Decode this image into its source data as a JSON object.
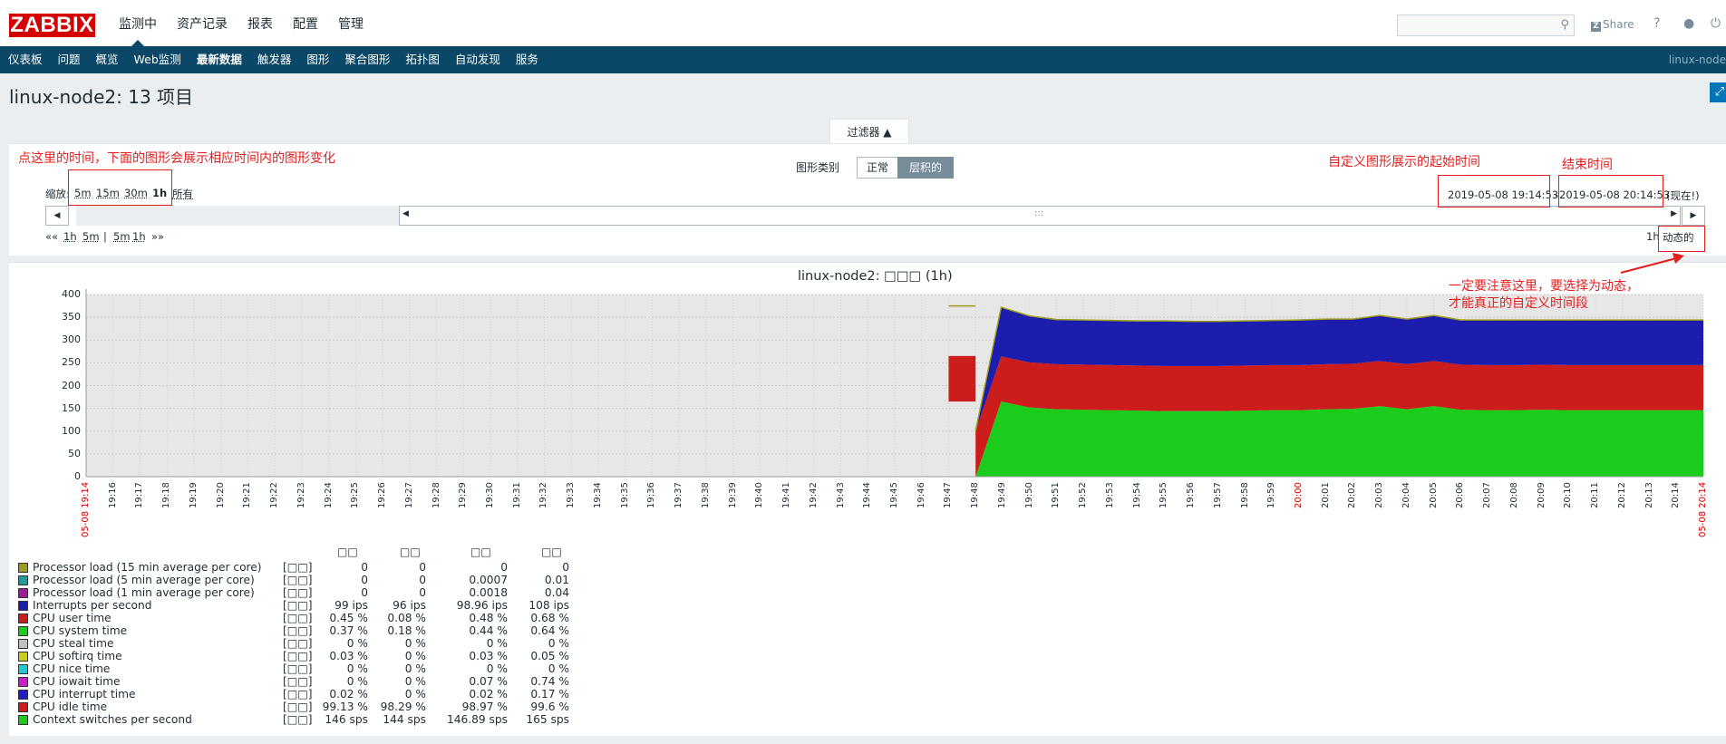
{
  "header": {
    "logo": "ZABBIX",
    "menu": [
      "监测中",
      "资产记录",
      "报表",
      "配置",
      "管理"
    ],
    "selected_menu": 0,
    "share": "Share",
    "help_icon": "?",
    "search_value": ""
  },
  "submenu": {
    "items": [
      "仪表板",
      "问题",
      "概览",
      "Web监测",
      "最新数据",
      "触发器",
      "图形",
      "聚合图形",
      "拓扑图",
      "自动发现",
      "服务"
    ],
    "selected": 4,
    "right_text": "linux-node"
  },
  "page": {
    "title": "linux-node2: 13 项目"
  },
  "filter": {
    "tab_label": "过滤器 ▲",
    "graph_type_label": "图形类别",
    "graph_type_options": [
      "正常",
      "层积的"
    ],
    "graph_type_selected": 1,
    "zoom_label": "缩放:",
    "zoom_options": [
      "5m",
      "15m",
      "30m",
      "1h",
      "所有"
    ],
    "zoom_selected": "1h",
    "date_from": "2019-05-08 19:14:53",
    "date_sep": "-",
    "date_to": "2019-05-08 20:14:53",
    "now_label": "(现在!)",
    "nav_back": [
      "«« ",
      "1h",
      "5m",
      "|",
      "5m",
      "1h",
      " »»"
    ],
    "period_label": "1h",
    "dynamic_label": "动态的"
  },
  "annotations": {
    "left": "点这里的时间，下面的图形会展示相应时间内的图形变化",
    "start": "自定义图形展示的起始时间",
    "end": "结束时间",
    "note_line1": "一定要注意这里，要选择为动态，",
    "note_line2": "才能真正的自定义时间段"
  },
  "chart_data": {
    "type": "area",
    "stacked": true,
    "title": "linux-node2: □□□ (1h)",
    "ylim": [
      0,
      400
    ],
    "yticks": [
      0,
      50,
      100,
      150,
      200,
      250,
      300,
      350,
      400
    ],
    "xticks": [
      "05-08 19:14",
      "19:16",
      "19:17",
      "19:18",
      "19:19",
      "19:20",
      "19:21",
      "19:22",
      "19:23",
      "19:24",
      "19:25",
      "19:26",
      "19:27",
      "19:28",
      "19:29",
      "19:30",
      "19:31",
      "19:32",
      "19:33",
      "19:34",
      "19:35",
      "19:36",
      "19:37",
      "19:38",
      "19:39",
      "19:40",
      "19:41",
      "19:42",
      "19:43",
      "19:44",
      "19:45",
      "19:46",
      "19:47",
      "19:48",
      "19:49",
      "19:50",
      "19:51",
      "19:52",
      "19:53",
      "19:54",
      "19:55",
      "19:56",
      "19:57",
      "19:58",
      "19:59",
      "20:00",
      "20:01",
      "20:02",
      "20:03",
      "20:04",
      "20:05",
      "20:06",
      "20:07",
      "20:08",
      "20:09",
      "20:10",
      "20:11",
      "20:12",
      "20:13",
      "20:14",
      "05-08 20:14"
    ],
    "xticks_red": [
      "05-08 19:14",
      "20:00",
      "05-08 20:14"
    ],
    "x_minutes": [
      33.0,
      33.95,
      35.0,
      36.0,
      37.0,
      38.0,
      39.0,
      40.0,
      41.0,
      42.0,
      43.0,
      44.0,
      45.0,
      46.0,
      47.0,
      48.0,
      49.0,
      50.0,
      51.0,
      52.0,
      53.0,
      54.0,
      55.0,
      56.0,
      57.0,
      58.0,
      59.0,
      60.0
    ],
    "series": [
      {
        "name": "Context switches per second",
        "color": "#1ccc1c",
        "values": [
          0,
          165,
          152,
          148,
          147,
          146,
          145,
          144,
          144,
          144,
          145,
          146,
          146,
          148,
          149,
          155,
          148,
          155,
          147,
          146,
          146,
          147,
          146,
          146,
          146,
          146,
          146,
          146
        ]
      },
      {
        "name": "CPU idle time",
        "color": "#cc1c1c",
        "values": [
          100,
          99,
          99,
          99,
          99,
          99,
          99,
          99,
          99,
          99,
          99,
          99,
          99,
          99,
          99,
          99,
          99,
          99,
          99,
          99,
          99,
          99,
          99,
          99,
          99,
          99,
          99,
          99
        ]
      },
      {
        "name": "Interrupts per second",
        "color": "#1c1cad",
        "values": [
          0,
          108,
          102,
          98,
          98,
          98,
          98,
          99,
          98,
          98,
          98,
          98,
          99,
          99,
          98,
          100,
          99,
          100,
          98,
          99,
          99,
          98,
          99,
          99,
          99,
          99,
          99,
          99
        ]
      }
    ],
    "pre_segment": {
      "from": 32.0,
      "to": 33.0,
      "total": 375,
      "mid": 265,
      "low": 165
    },
    "legend_headers": [
      "□□",
      "□□",
      "□□",
      "□□"
    ],
    "legend": [
      {
        "name": "Processor load (15 min average per core)",
        "func": "[□□]",
        "color": "#9c9c1c",
        "values": [
          "0",
          "0",
          "0",
          "0"
        ]
      },
      {
        "name": "Processor load (5 min average per core)",
        "func": "[□□]",
        "color": "#1c9c9c",
        "values": [
          "0",
          "0",
          "0.0007",
          "0.01"
        ]
      },
      {
        "name": "Processor load (1 min average per core)",
        "func": "[□□]",
        "color": "#9c1c9c",
        "values": [
          "0",
          "0",
          "0.0018",
          "0.04"
        ]
      },
      {
        "name": "Interrupts per second",
        "func": "[□□]",
        "color": "#1c1cad",
        "values": [
          "99 ips",
          "96 ips",
          "98.96 ips",
          "108 ips"
        ]
      },
      {
        "name": "CPU user time",
        "func": "[□□]",
        "color": "#cc1c1c",
        "values": [
          "0.45 %",
          "0.08 %",
          "0.48 %",
          "0.68 %"
        ]
      },
      {
        "name": "CPU system time",
        "func": "[□□]",
        "color": "#1ccc1c",
        "values": [
          "0.37 %",
          "0.18 %",
          "0.44 %",
          "0.64 %"
        ]
      },
      {
        "name": "CPU steal time",
        "func": "[□□]",
        "color": "#c0c0c0",
        "values": [
          "0 %",
          "0 %",
          "0 %",
          "0 %"
        ]
      },
      {
        "name": "CPU softirq time",
        "func": "[□□]",
        "color": "#cccc1c",
        "values": [
          "0.03 %",
          "0 %",
          "0.03 %",
          "0.05 %"
        ]
      },
      {
        "name": "CPU nice time",
        "func": "[□□]",
        "color": "#1ccccc",
        "values": [
          "0 %",
          "0 %",
          "0 %",
          "0 %"
        ]
      },
      {
        "name": "CPU iowait time",
        "func": "[□□]",
        "color": "#cc1ccc",
        "values": [
          "0 %",
          "0 %",
          "0.07 %",
          "0.74 %"
        ]
      },
      {
        "name": "CPU interrupt time",
        "func": "[□□]",
        "color": "#1c1ccc",
        "values": [
          "0.02 %",
          "0 %",
          "0.02 %",
          "0.17 %"
        ]
      },
      {
        "name": "CPU idle time",
        "func": "[□□]",
        "color": "#cc1c1c",
        "values": [
          "99.13 %",
          "98.29 %",
          "98.97 %",
          "99.6 %"
        ]
      },
      {
        "name": "Context switches per second",
        "func": "[□□]",
        "color": "#1ccc1c",
        "values": [
          "146 sps",
          "144 sps",
          "146.89 sps",
          "165 sps"
        ]
      }
    ]
  }
}
